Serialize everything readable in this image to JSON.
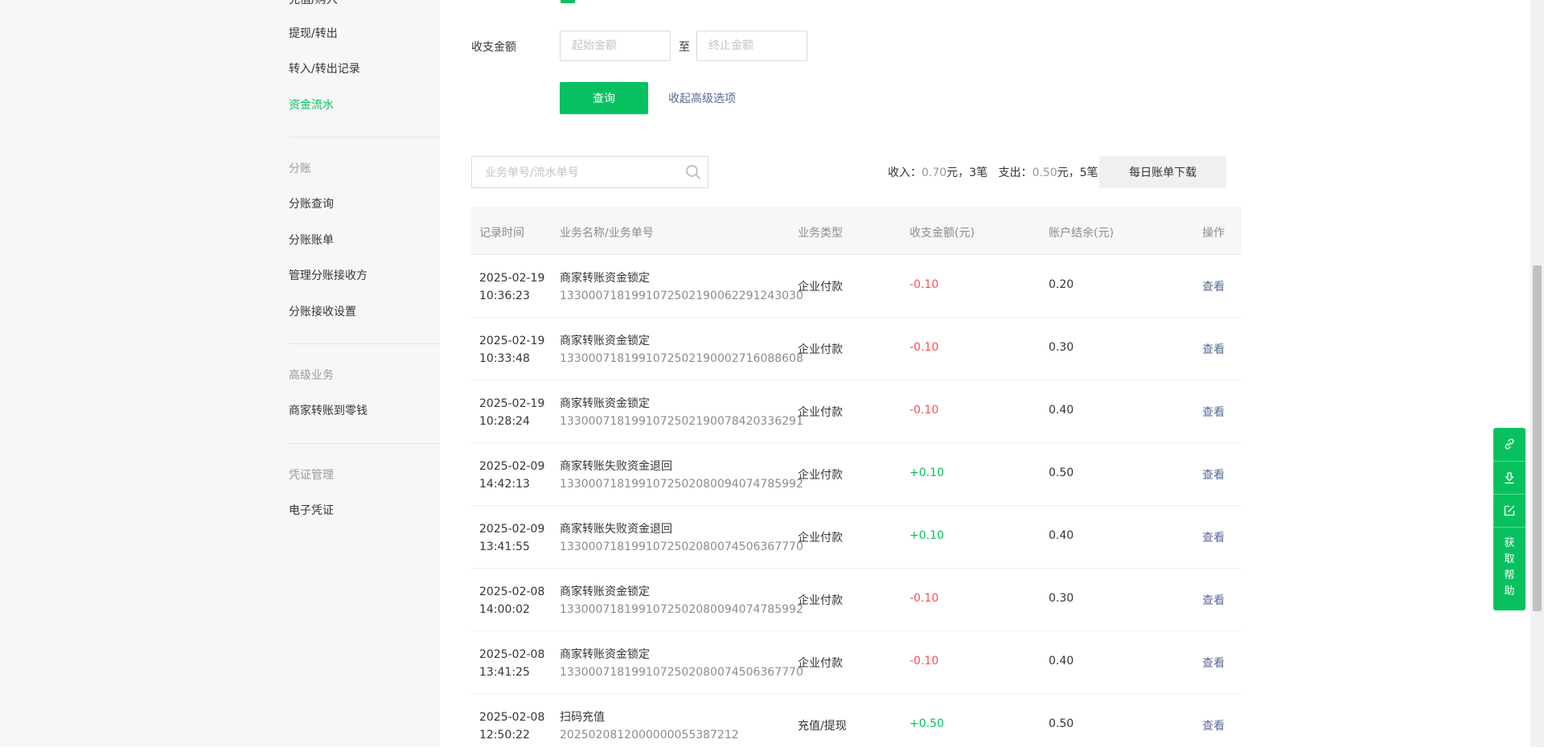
{
  "sidebar": {
    "cut_item": "充值/购入",
    "items_top": [
      "提现/转出",
      "转入/转出记录",
      "资金流水"
    ],
    "group_fenzhang": "分账",
    "items_fenzhang": [
      "分账查询",
      "分账账单",
      "管理分账接收方",
      "分账接收设置"
    ],
    "group_advanced": "高级业务",
    "items_advanced": [
      "商家转账到零钱"
    ],
    "group_voucher": "凭证管理",
    "items_voucher": [
      "电子凭证"
    ]
  },
  "filter": {
    "amount_label": "收支金额",
    "min_placeholder": "起始金额",
    "max_placeholder": "终止金额",
    "to_text": "至",
    "query_button": "查询",
    "collapse_link": "收起高级选项"
  },
  "search": {
    "placeholder": "业务单号/流水单号"
  },
  "summary": {
    "income_label": "收入：",
    "income_amount": "0.70",
    "income_tail": "元，3笔",
    "expense_label": "支出：",
    "expense_amount": "0.50",
    "expense_tail": "元，5笔",
    "download_button": "每日账单下载"
  },
  "table": {
    "headers": [
      "记录时间",
      "业务名称/业务单号",
      "业务类型",
      "收支金额(元)",
      "账户结余(元)",
      "操作"
    ],
    "rows": [
      {
        "date": "2025-02-19",
        "time": "10:36:23",
        "name": "商家转账资金锁定",
        "no": "1330007181991072502190062291243030",
        "type": "企业付款",
        "amount": "-0.10",
        "balance": "0.20",
        "op": "查看"
      },
      {
        "date": "2025-02-19",
        "time": "10:33:48",
        "name": "商家转账资金锁定",
        "no": "1330007181991072502190002716088608",
        "type": "企业付款",
        "amount": "-0.10",
        "balance": "0.30",
        "op": "查看"
      },
      {
        "date": "2025-02-19",
        "time": "10:28:24",
        "name": "商家转账资金锁定",
        "no": "1330007181991072502190078420336291",
        "type": "企业付款",
        "amount": "-0.10",
        "balance": "0.40",
        "op": "查看"
      },
      {
        "date": "2025-02-09",
        "time": "14:42:13",
        "name": "商家转账失败资金退回",
        "no": "1330007181991072502080094074785992",
        "type": "企业付款",
        "amount": "+0.10",
        "balance": "0.50",
        "op": "查看"
      },
      {
        "date": "2025-02-09",
        "time": "13:41:55",
        "name": "商家转账失败资金退回",
        "no": "1330007181991072502080074506367770",
        "type": "企业付款",
        "amount": "+0.10",
        "balance": "0.40",
        "op": "查看"
      },
      {
        "date": "2025-02-08",
        "time": "14:00:02",
        "name": "商家转账资金锁定",
        "no": "1330007181991072502080094074785992",
        "type": "企业付款",
        "amount": "-0.10",
        "balance": "0.30",
        "op": "查看"
      },
      {
        "date": "2025-02-08",
        "time": "13:41:25",
        "name": "商家转账资金锁定",
        "no": "1330007181991072502080074506367770",
        "type": "企业付款",
        "amount": "-0.10",
        "balance": "0.40",
        "op": "查看"
      },
      {
        "date": "2025-02-08",
        "time": "12:50:22",
        "name": "扫码充值",
        "no": "2025020812000000055387212",
        "type": "充值/提现",
        "amount": "+0.50",
        "balance": "0.50",
        "op": "查看"
      }
    ]
  },
  "float_panel": {
    "icons": [
      "link-icon",
      "download-icon",
      "edit-icon"
    ],
    "help_chars": [
      "获",
      "取",
      "帮",
      "助"
    ]
  },
  "colors": {
    "accent": "#07c160",
    "link": "#576b95",
    "negative": "#fa5151"
  }
}
